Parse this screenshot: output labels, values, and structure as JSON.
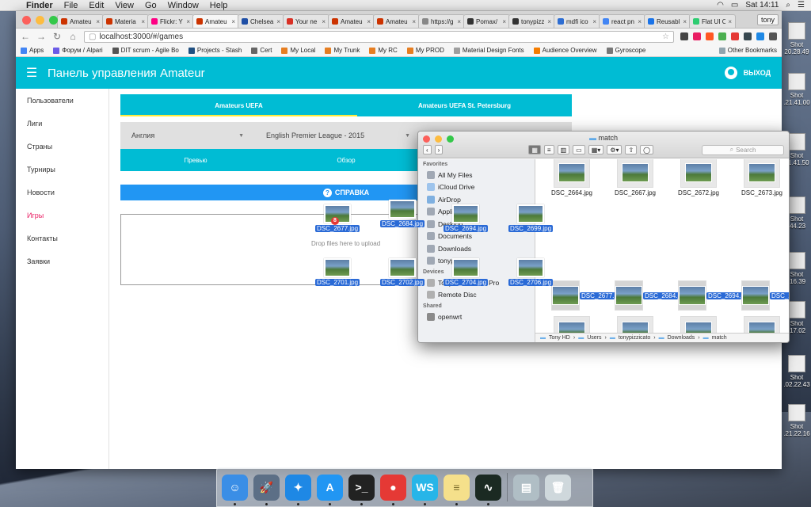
{
  "menubar": {
    "app": "Finder",
    "items": [
      "File",
      "Edit",
      "View",
      "Go",
      "Window",
      "Help"
    ],
    "clock": "Sat 14:11"
  },
  "desktop_files": [
    {
      "label": "Shot\n20.28.49"
    },
    {
      "label": "Shot\n.21.41.00"
    },
    {
      "label": "Shot\n21.41.50"
    },
    {
      "label": "Shot\n.44.23"
    },
    {
      "label": "Shot\n.16.39"
    },
    {
      "label": "Shot\n.17.02"
    },
    {
      "label": "Shot\n.02.22.43"
    },
    {
      "label": "Shot\n.21.22.16"
    }
  ],
  "browser": {
    "tabs": [
      {
        "title": "Amateu",
        "color": "#cc3300"
      },
      {
        "title": "Materia",
        "color": "#cc3300"
      },
      {
        "title": "Flickr: Y",
        "color": "#ff0084"
      },
      {
        "title": "Amateu",
        "color": "#cc3300"
      },
      {
        "title": "Chelsea",
        "color": "#1f4fa6"
      },
      {
        "title": "Your ne",
        "color": "#d93025"
      },
      {
        "title": "Amateu",
        "color": "#cc3300"
      },
      {
        "title": "Amateu",
        "color": "#cc3300"
      },
      {
        "title": "https://g",
        "color": "#888888"
      },
      {
        "title": "Pomax/",
        "color": "#333333"
      },
      {
        "title": "tonypizz",
        "color": "#333333"
      },
      {
        "title": "mdfi ico",
        "color": "#2d6dd2"
      },
      {
        "title": "react pn",
        "color": "#4285f4"
      },
      {
        "title": "Reusabl",
        "color": "#1a73e8"
      },
      {
        "title": "Flat UI C",
        "color": "#2ecc71"
      }
    ],
    "active_tab": 3,
    "profile": "tony",
    "url": "localhost:3000/#/games",
    "bookmarks": [
      {
        "label": "Apps",
        "color": "#4285f4"
      },
      {
        "label": "Форум / Alpari",
        "color": "#6c5ce7"
      },
      {
        "label": "DIT scrum - Agile Bo",
        "color": "#555555"
      },
      {
        "label": "Projects - Stash",
        "color": "#205081"
      },
      {
        "label": "Cert",
        "color": "#666666"
      },
      {
        "label": "My Local",
        "color": "#e67e22"
      },
      {
        "label": "My Trunk",
        "color": "#e67e22"
      },
      {
        "label": "My RC",
        "color": "#e67e22"
      },
      {
        "label": "My PROD",
        "color": "#e67e22"
      },
      {
        "label": "Material Design Fonts",
        "color": "#9e9e9e"
      },
      {
        "label": "Audience Overview",
        "color": "#f57c00"
      },
      {
        "label": "Gyroscope",
        "color": "#777777"
      }
    ],
    "other_bookmarks": "Other Bookmarks"
  },
  "app": {
    "title": "Панель управления Amateur",
    "logout": "ВЫХОД",
    "nav": [
      "Пользователи",
      "Лиги",
      "Страны",
      "Турниры",
      "Новости",
      "Игры",
      "Контакты",
      "Заявки"
    ],
    "active_nav": 5,
    "league_tabs": [
      "Amateurs UEFA",
      "Amateurs UEFA St. Petersburg"
    ],
    "country_select": "Англия",
    "league_select": "English Premier League - 2015",
    "sub_tabs": [
      "Превью",
      "Обзор",
      ""
    ],
    "help": "СПРАВКА",
    "dropzone_text": "Drop files here to upload"
  },
  "drag": {
    "count_badge": "8",
    "files": [
      "DSC_2677.jpg",
      "DSC_2684.jpg",
      "DSC_2694.jpg",
      "DSC_2699.jpg",
      "DSC_2701.jpg",
      "DSC_2702.jpg",
      "DSC_2704.jpg",
      "DSC_2706.jpg"
    ]
  },
  "finder": {
    "title": "match",
    "search_placeholder": "Search",
    "favorites_header": "Favorites",
    "favorites": [
      "All My Files",
      "iCloud Drive",
      "AirDrop",
      "Applications",
      "Desktop",
      "Documents",
      "Downloads",
      "tonypizzicato"
    ],
    "devices_header": "Devices",
    "devices": [
      "Tony's MacBook Pro",
      "Remote Disc"
    ],
    "shared_header": "Shared",
    "shared": [
      "openwrt"
    ],
    "files": [
      {
        "name": "DSC_2664.jpg",
        "selected": false
      },
      {
        "name": "DSC_2667.jpg",
        "selected": false
      },
      {
        "name": "DSC_2672.jpg",
        "selected": false
      },
      {
        "name": "DSC_2673.jpg",
        "selected": false
      },
      {
        "name": "DSC_2677.jpg",
        "selected": true
      },
      {
        "name": "DSC_2684.jpg",
        "selected": true
      },
      {
        "name": "DSC_2694.jpg",
        "selected": true
      },
      {
        "name": "DSC_2699.jpg",
        "selected": true
      },
      {
        "name": "DSC_2701.jpg",
        "selected": true
      },
      {
        "name": "DSC_2702.jpg",
        "selected": true
      },
      {
        "name": "DSC_2704.jpg",
        "selected": true
      },
      {
        "name": "DSC_2706.jpg",
        "selected": true
      },
      {
        "name": "",
        "selected": false
      },
      {
        "name": "",
        "selected": false
      },
      {
        "name": "",
        "selected": false
      },
      {
        "name": "",
        "selected": false
      }
    ],
    "path": [
      "Tony HD",
      "Users",
      "tonypizzicato",
      "Downloads",
      "match"
    ]
  },
  "dock": [
    {
      "name": "finder-icon",
      "color": "#3a8ee6",
      "glyph": "☺"
    },
    {
      "name": "launchpad-icon",
      "color": "#5c6f86",
      "glyph": "🚀"
    },
    {
      "name": "safari-icon",
      "color": "#1e88e5",
      "glyph": "✦"
    },
    {
      "name": "app-store-icon",
      "color": "#2196f3",
      "glyph": "A"
    },
    {
      "name": "terminal-icon",
      "color": "#222222",
      "glyph": ">_"
    },
    {
      "name": "chrome-icon",
      "color": "#e53935",
      "glyph": "●"
    },
    {
      "name": "webstorm-icon",
      "color": "#27b5e8",
      "glyph": "WS"
    },
    {
      "name": "notes-icon",
      "color": "#f5e08b",
      "glyph": "≡"
    },
    {
      "name": "activity-monitor-icon",
      "color": "#1b2a22",
      "glyph": "∿"
    },
    {
      "name": "preview-icon",
      "color": "#b0bec5",
      "glyph": "▤"
    },
    {
      "name": "trash-icon",
      "color": "#cfd8dc",
      "glyph": "🗑"
    }
  ]
}
